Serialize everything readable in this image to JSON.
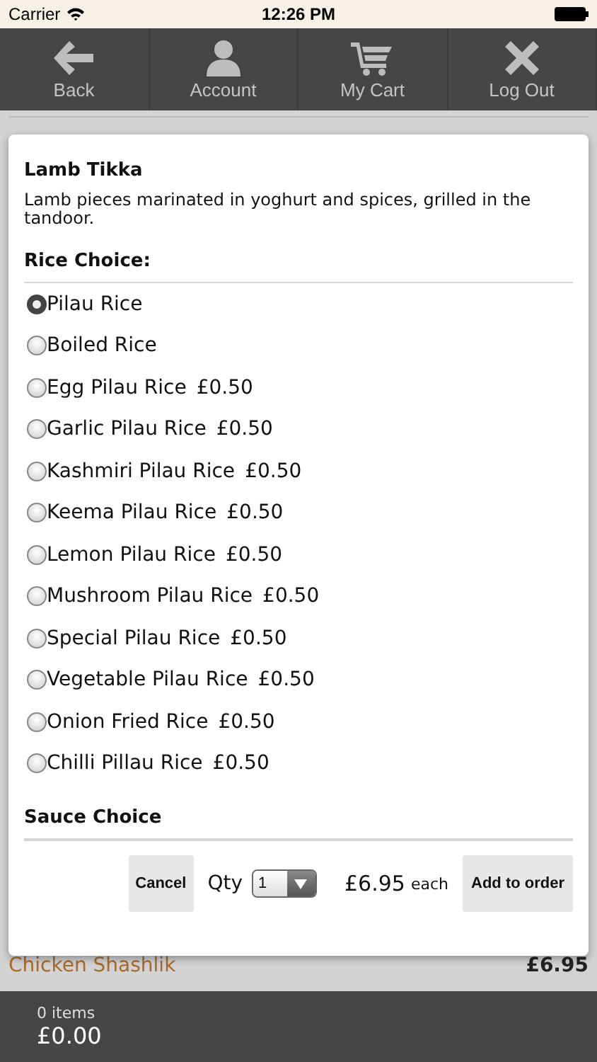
{
  "status_bar": {
    "carrier": "Carrier",
    "time": "12:26 PM"
  },
  "nav": [
    {
      "label": "Back",
      "kind": "back"
    },
    {
      "label": "Account",
      "kind": "account"
    },
    {
      "label": "My Cart",
      "kind": "cart"
    },
    {
      "label": "Log Out",
      "kind": "logout"
    }
  ],
  "background_item": {
    "name": "Chicken Shashlik",
    "price": "£6.95"
  },
  "modal": {
    "title": "Lamb Tikka",
    "description": "Lamb pieces marinated in yoghurt and spices, grilled in the tandoor.",
    "sections": [
      {
        "heading": "Rice Choice:",
        "options": [
          {
            "label": "Pilau Rice",
            "selected": true
          },
          {
            "label": "Boiled Rice",
            "selected": false
          },
          {
            "label": "Egg Pilau Rice",
            "price": "£0.50",
            "selected": false
          },
          {
            "label": "Garlic Pilau Rice",
            "price": "£0.50",
            "selected": false
          },
          {
            "label": "Kashmiri Pilau Rice",
            "price": "£0.50",
            "selected": false
          },
          {
            "label": "Keema Pilau Rice",
            "price": "£0.50",
            "selected": false
          },
          {
            "label": "Lemon Pilau Rice",
            "price": "£0.50",
            "selected": false
          },
          {
            "label": "Mushroom Pilau Rice",
            "price": "£0.50",
            "selected": false
          },
          {
            "label": "Special Pilau Rice",
            "price": "£0.50",
            "selected": false
          },
          {
            "label": "Vegetable Pilau Rice",
            "price": "£0.50",
            "selected": false
          },
          {
            "label": "Onion Fried Rice",
            "price": "£0.50",
            "selected": false
          },
          {
            "label": "Chilli Pillau Rice",
            "price": "£0.50",
            "selected": false
          }
        ]
      },
      {
        "heading": "Sauce Choice"
      }
    ],
    "actions": {
      "cancel": "Cancel",
      "qty_label": "Qty",
      "qty_value": "1",
      "price": "£6.95",
      "price_unit": "each",
      "add": "Add to order"
    }
  },
  "cart": {
    "items": "0 items",
    "total": "£0.00"
  }
}
